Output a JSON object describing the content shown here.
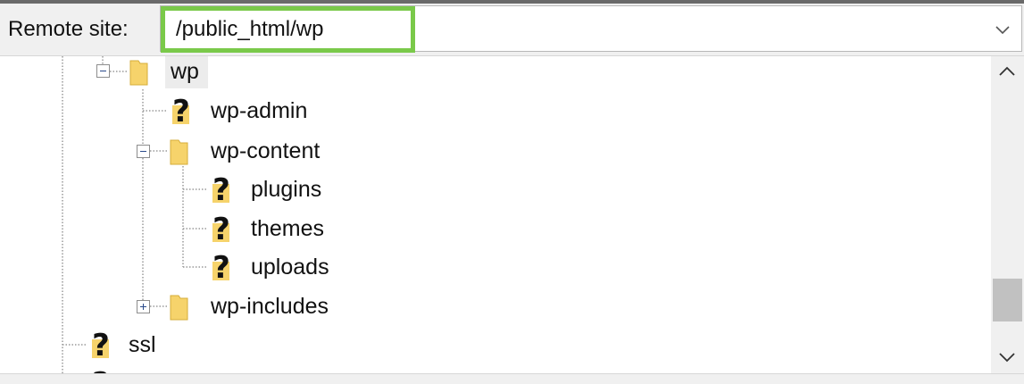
{
  "address_bar": {
    "label": "Remote site:",
    "value": "/public_html/wp",
    "highlight_color": "#7ac94a"
  },
  "tree": {
    "nodes": [
      {
        "label": "wp",
        "icon": "folder-icon",
        "expander": "collapse",
        "selected": true
      },
      {
        "label": "wp-admin",
        "icon": "question-folder-icon"
      },
      {
        "label": "wp-content",
        "icon": "folder-icon",
        "expander": "collapse"
      },
      {
        "label": "plugins",
        "icon": "question-folder-icon"
      },
      {
        "label": "themes",
        "icon": "question-folder-icon"
      },
      {
        "label": "uploads",
        "icon": "question-folder-icon"
      },
      {
        "label": "wp-includes",
        "icon": "folder-icon",
        "expander": "expand"
      },
      {
        "label": "ssl",
        "icon": "question-folder-icon"
      }
    ]
  },
  "colors": {
    "folder": "#f6d36b",
    "question_mark": "#111111",
    "guide_line": "#9a9a9a"
  }
}
